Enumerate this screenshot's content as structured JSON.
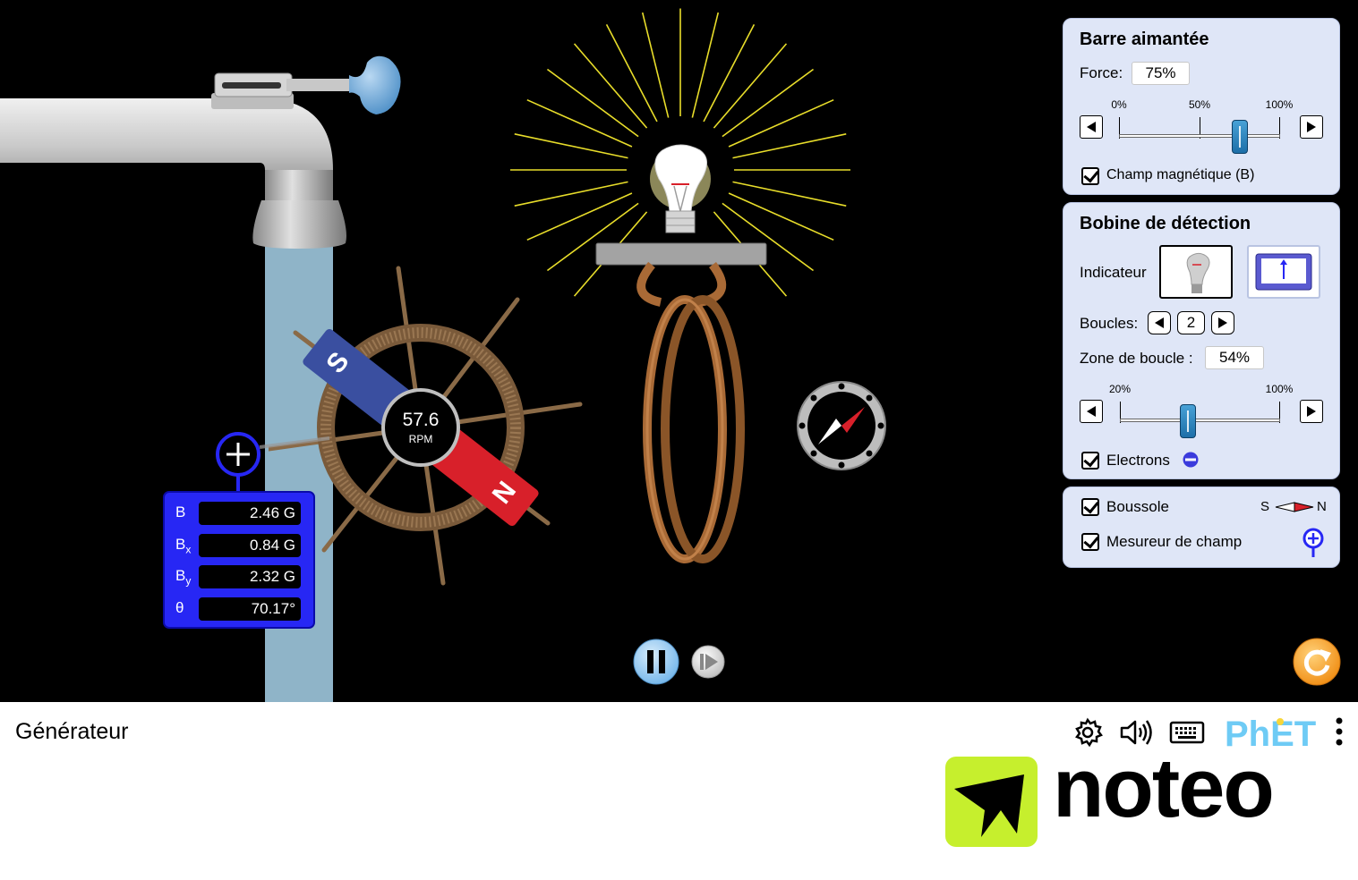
{
  "footer": {
    "title": "Générateur",
    "brand": "PhET"
  },
  "watermark": {
    "text": "noteo",
    "color": "#c6ef2d"
  },
  "rpm": {
    "value": "57.6",
    "unit": "RPM"
  },
  "field_meter": {
    "rows": [
      {
        "key": "B",
        "sub": "",
        "value": "2.46 G"
      },
      {
        "key": "B",
        "sub": "x",
        "value": "0.84 G"
      },
      {
        "key": "B",
        "sub": "y",
        "value": "2.32 G"
      },
      {
        "key": "θ",
        "sub": "",
        "value": "70.17°"
      }
    ]
  },
  "magnet": {
    "south_label": "S",
    "north_label": "N",
    "south_color": "#3a4fa0",
    "north_color": "#d8202a"
  },
  "panel_magnet": {
    "title": "Barre aimantée",
    "force_label": "Force:",
    "force_value": "75%",
    "ticks": [
      "0%",
      "50%",
      "100%"
    ],
    "slider_fraction": 0.75,
    "field_checkbox": "Champ magnétique (B)"
  },
  "panel_coil": {
    "title": "Bobine de détection",
    "indicator_label": "Indicateur",
    "loops_label": "Boucles:",
    "loops_value": "2",
    "area_label": "Zone de boucle :",
    "area_value": "54%",
    "ticks": [
      "20%",
      "100%"
    ],
    "slider_fraction": 0.425,
    "electrons_label": "Electrons"
  },
  "panel_tools": {
    "compass_label": "Boussole",
    "compass_s": "S",
    "compass_n": "N",
    "meter_label": "Mesureur de champ"
  },
  "icons": [
    "settings-icon",
    "sound-icon",
    "keyboard-icon",
    "menu-dots-icon",
    "reset-icon",
    "pause-icon",
    "step-icon"
  ],
  "colors": {
    "accent": "#2727f4",
    "panel_bg": "#dfe6f7",
    "water": "#8fb4c8",
    "reset": "#f59a1e"
  }
}
